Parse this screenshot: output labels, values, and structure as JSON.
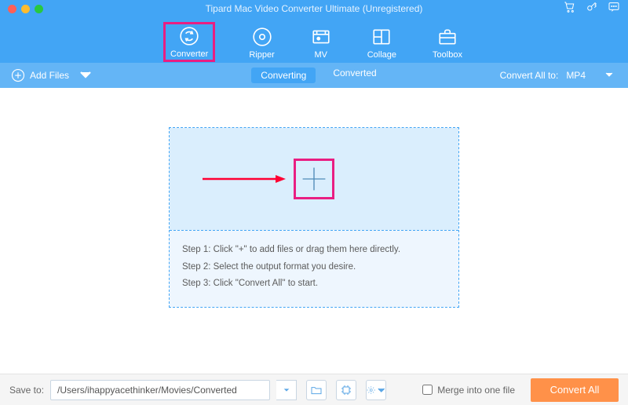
{
  "app": {
    "title": "Tipard Mac Video Converter Ultimate (Unregistered)"
  },
  "tabs": {
    "converter": "Converter",
    "ripper": "Ripper",
    "mv": "MV",
    "collage": "Collage",
    "toolbox": "Toolbox"
  },
  "subbar": {
    "add_files": "Add Files",
    "converting": "Converting",
    "converted": "Converted",
    "convert_all_to": "Convert All to:",
    "format": "MP4"
  },
  "drop": {
    "step1": "Step 1: Click \"+\" to add files or drag them here directly.",
    "step2": "Step 2: Select the output format you desire.",
    "step3": "Step 3: Click \"Convert All\" to start."
  },
  "footer": {
    "save_to": "Save to:",
    "path": "/Users/ihappyacethinker/Movies/Converted",
    "merge": "Merge into one file",
    "convert_all": "Convert All"
  }
}
